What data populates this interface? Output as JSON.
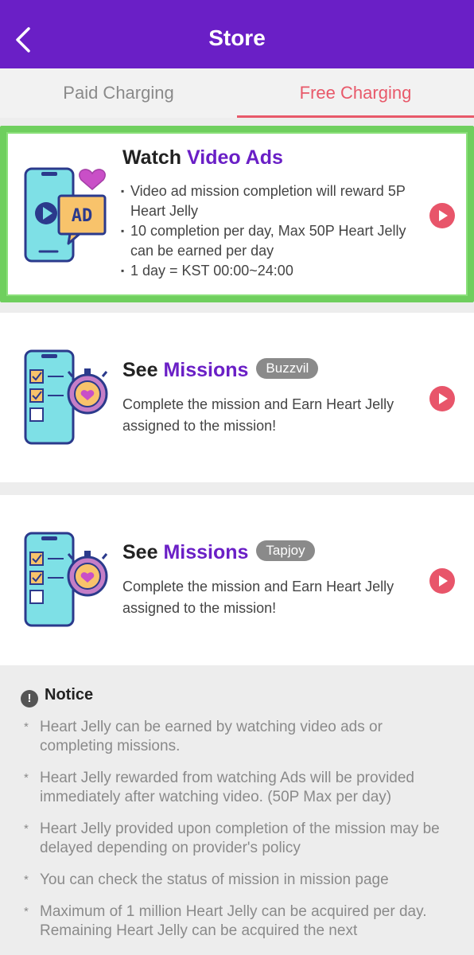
{
  "header": {
    "title": "Store"
  },
  "tabs": [
    {
      "label": "Paid Charging",
      "active": false
    },
    {
      "label": "Free Charging",
      "active": true
    }
  ],
  "cards": [
    {
      "title_prefix": "Watch ",
      "title_accent": "Video Ads",
      "bullets": [
        "Video ad mission completion will reward 5P Heart Jelly",
        "10 completion per day, Max 50P Heart Jelly can be earned per day",
        "1 day = KST 00:00~24:00"
      ],
      "icon_text": "AD"
    },
    {
      "title_prefix": "See ",
      "title_accent": "Missions",
      "badge": "Buzzvil",
      "description": "Complete the mission and Earn Heart Jelly assigned to the mission!"
    },
    {
      "title_prefix": "See ",
      "title_accent": "Missions",
      "badge": "Tapjoy",
      "description": "Complete the mission and Earn Heart Jelly assigned to the mission!"
    }
  ],
  "notice": {
    "title": "Notice",
    "items": [
      "Heart Jelly can be earned by watching video ads or completing missions.",
      "Heart Jelly rewarded from watching Ads will be provided immediately after watching video. (50P Max per day)",
      "Heart Jelly provided upon completion of the mission may be delayed depending on provider's policy",
      "You can check the status of mission in mission page",
      "Maximum of 1 million Heart Jelly can be acquired per day. Remaining Heart Jelly can be acquired the next"
    ]
  },
  "colors": {
    "primary": "#6a1fc6",
    "accent": "#e8596a",
    "highlight": "#6fcf5e"
  }
}
